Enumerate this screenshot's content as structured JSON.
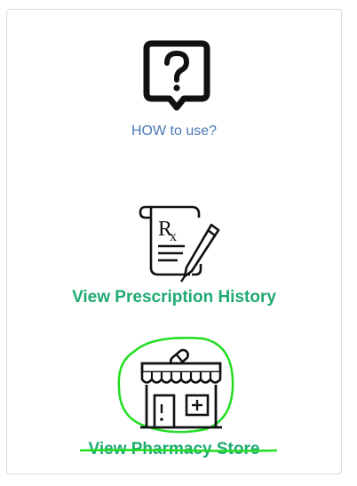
{
  "menu": {
    "help": {
      "label": "HOW to use?",
      "icon": "question-bubble-icon",
      "color": "#4a78b5"
    },
    "prescription_history": {
      "label": "View Prescription History",
      "icon": "prescription-icon",
      "color": "#1eaa70"
    },
    "pharmacy_store": {
      "label": "View Pharmacy Store",
      "icon": "pharmacy-store-icon",
      "color": "#1eaa70",
      "annotation_color": "#22dd22"
    }
  }
}
